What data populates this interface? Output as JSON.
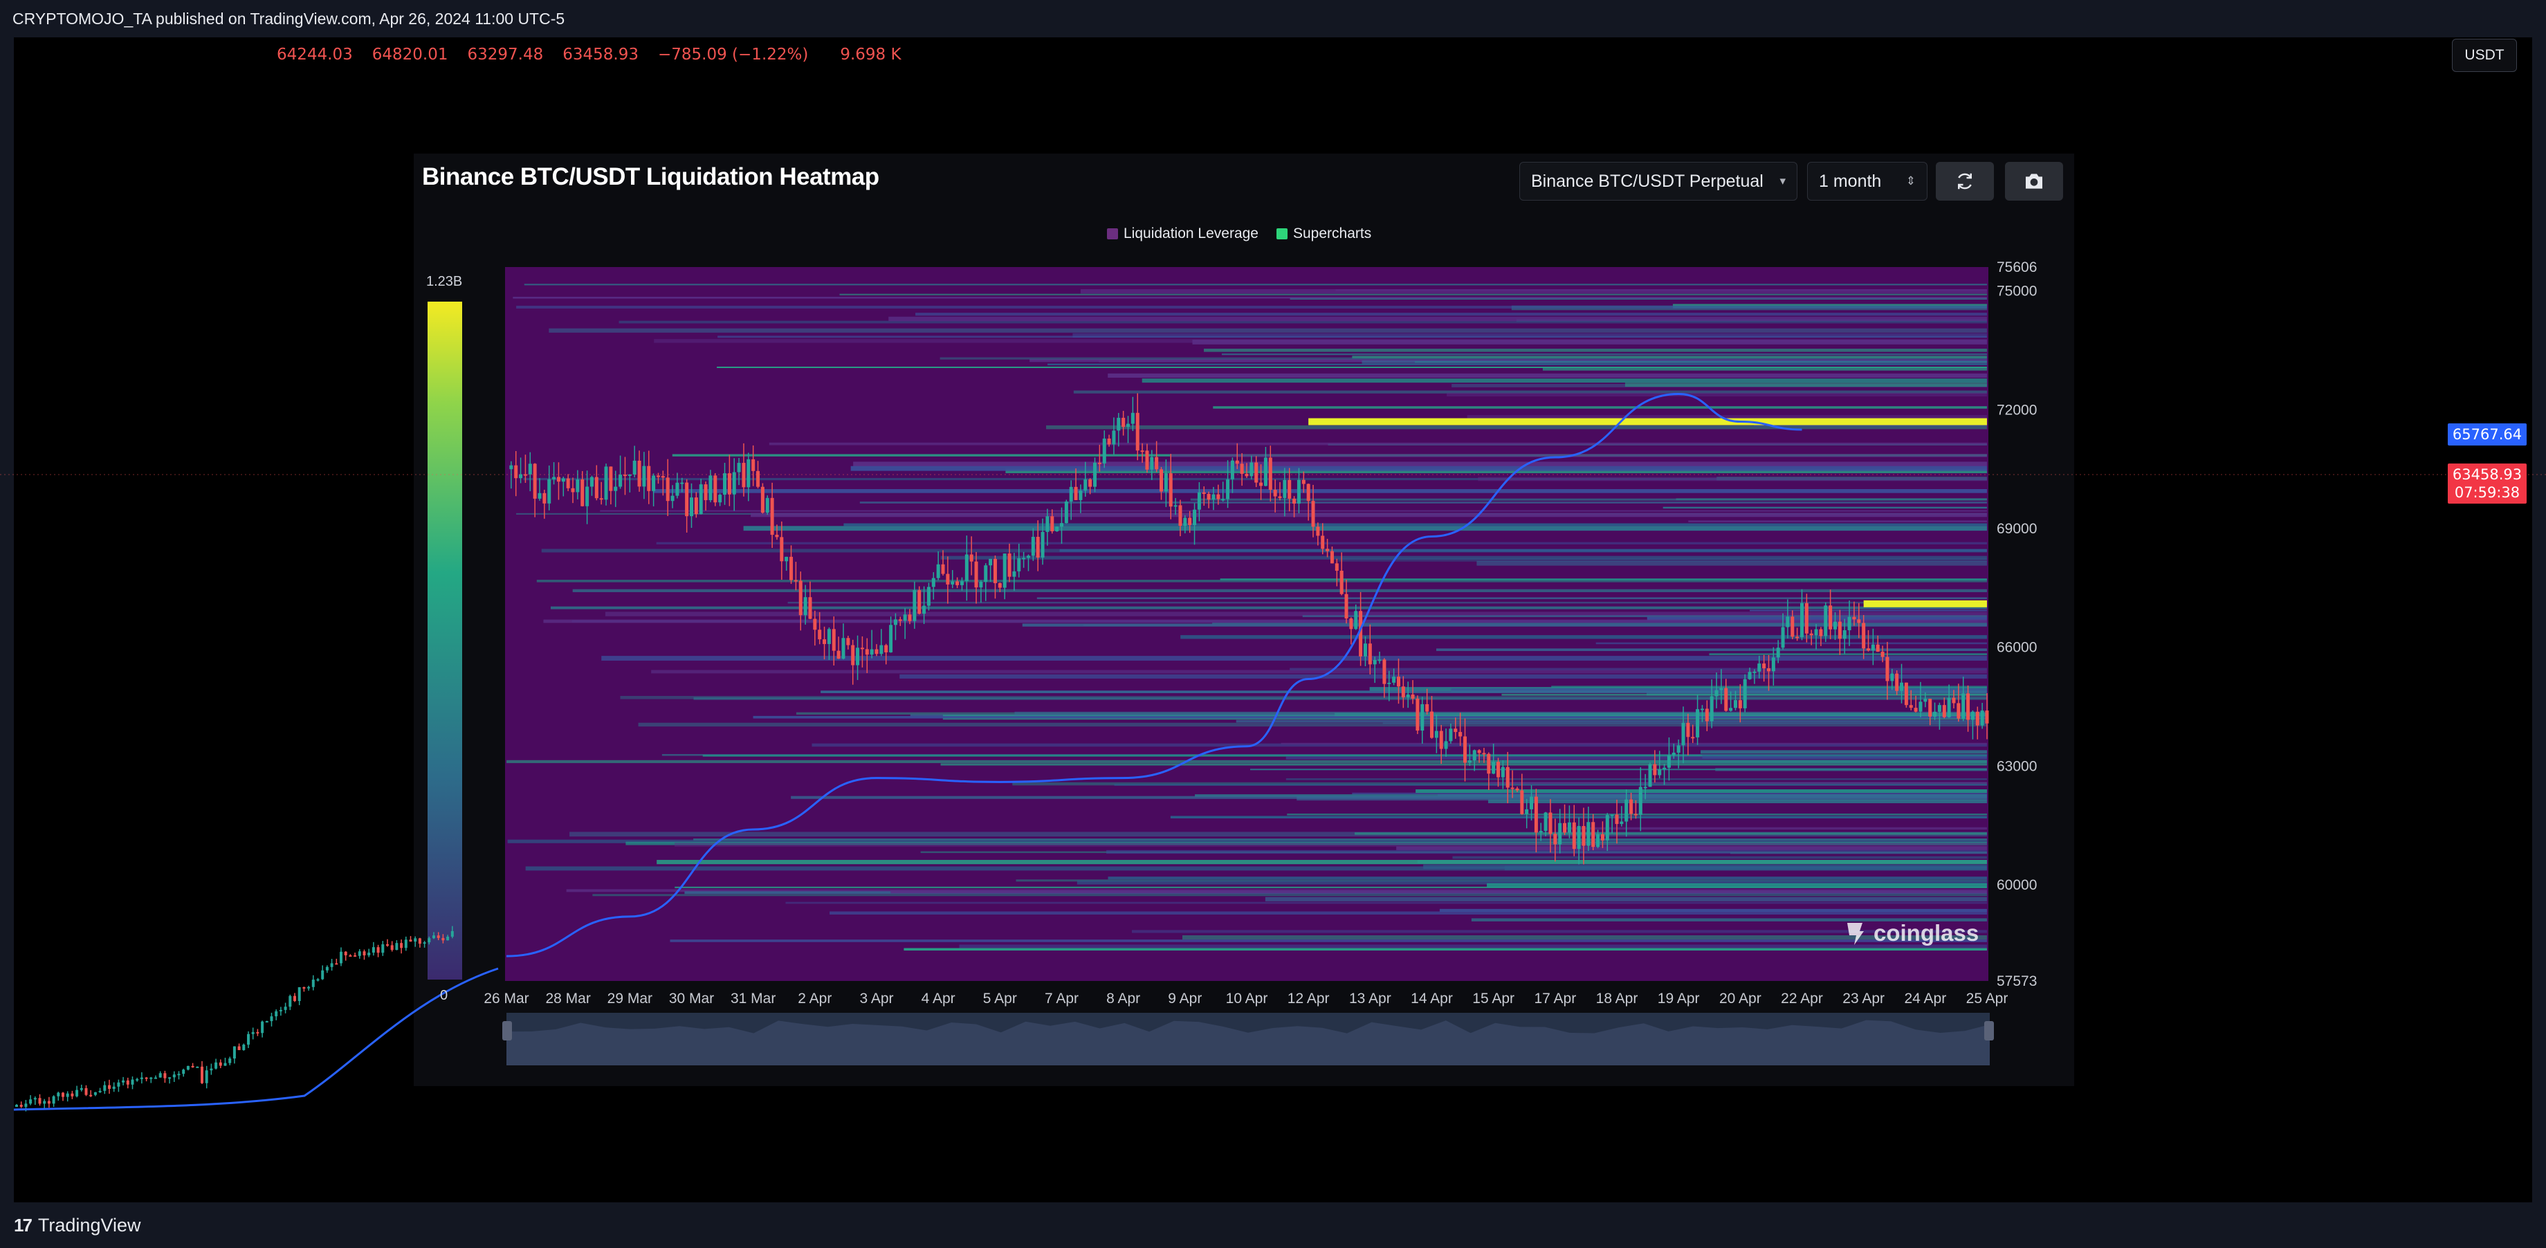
{
  "header": {
    "published_line": "CRYPTOMOJO_TA published on TradingView.com, Apr 26, 2024 11:00 UTC-5"
  },
  "ohlc": {
    "open": "64244.03",
    "high": "64820.01",
    "low": "63297.48",
    "close": "63458.93",
    "change": "−785.09 (−1.22%)",
    "volume": "9.698 K"
  },
  "currency_button": "USDT",
  "price_tags": {
    "line_value": "65767.64",
    "last_price": "63458.93",
    "countdown": "07:59:38"
  },
  "heatmap_panel": {
    "title": "Binance BTC/USDT Liquidation Heatmap",
    "pair_select": "Binance BTC/USDT Perpetual",
    "range_select": "1 month",
    "refresh_icon": "refresh-icon",
    "camera_icon": "camera-icon",
    "legend": [
      {
        "label": "Liquidation Leverage",
        "color": "#6b2e7f"
      },
      {
        "label": "Supercharts",
        "color": "#2ed47a"
      }
    ],
    "colorbar_max": "1.23B",
    "colorbar_min": "0",
    "watermark": "coinglass"
  },
  "footer": {
    "brand": "TradingView",
    "logo_glyph": "17"
  },
  "colors": {
    "heat_bg": "#4a0a5e",
    "heat_high": "#e8f02a",
    "candle_up": "#26a69a",
    "candle_down": "#ef5350",
    "ma_line": "#2962ff"
  },
  "chart_data": {
    "type": "heatmap",
    "title": "Binance BTC/USDT Liquidation Heatmap",
    "x_ticks": [
      "26 Mar",
      "28 Mar",
      "29 Mar",
      "30 Mar",
      "31 Mar",
      "2 Apr",
      "3 Apr",
      "4 Apr",
      "5 Apr",
      "7 Apr",
      "8 Apr",
      "9 Apr",
      "10 Apr",
      "12 Apr",
      "13 Apr",
      "14 Apr",
      "15 Apr",
      "17 Apr",
      "18 Apr",
      "19 Apr",
      "20 Apr",
      "22 Apr",
      "23 Apr",
      "24 Apr",
      "25 Apr"
    ],
    "y_ticks": [
      "75606",
      "75000",
      "72000",
      "69000",
      "66000",
      "63000",
      "60000",
      "57573"
    ],
    "ylim": [
      57573,
      75606
    ],
    "bright_liquidation_levels": [
      {
        "price": 71700,
        "from": "12 Apr",
        "to": "25 Apr"
      },
      {
        "price": 67100,
        "from": "23 Apr",
        "to": "25 Apr"
      }
    ],
    "price_close_path": [
      {
        "date": "26 Mar",
        "close": 70500
      },
      {
        "date": "28 Mar",
        "close": 69800
      },
      {
        "date": "29 Mar",
        "close": 70400
      },
      {
        "date": "30 Mar",
        "close": 69700
      },
      {
        "date": "31 Mar",
        "close": 70400
      },
      {
        "date": "2 Apr",
        "close": 66200
      },
      {
        "date": "3 Apr",
        "close": 65700
      },
      {
        "date": "4 Apr",
        "close": 68000
      },
      {
        "date": "5 Apr",
        "close": 67900
      },
      {
        "date": "7 Apr",
        "close": 69200
      },
      {
        "date": "8 Apr",
        "close": 71900
      },
      {
        "date": "9 Apr",
        "close": 69200
      },
      {
        "date": "10 Apr",
        "close": 70600
      },
      {
        "date": "12 Apr",
        "close": 69800
      },
      {
        "date": "13 Apr",
        "close": 65500
      },
      {
        "date": "14 Apr",
        "close": 64000
      },
      {
        "date": "15 Apr",
        "close": 63000
      },
      {
        "date": "17 Apr",
        "close": 61200
      },
      {
        "date": "18 Apr",
        "close": 61400
      },
      {
        "date": "19 Apr",
        "close": 63900
      },
      {
        "date": "20 Apr",
        "close": 64900
      },
      {
        "date": "22 Apr",
        "close": 66800
      },
      {
        "date": "23 Apr",
        "close": 66400
      },
      {
        "date": "24 Apr",
        "close": 64300
      },
      {
        "date": "25 Apr",
        "close": 64500
      }
    ],
    "ma_path": [
      {
        "date": "26 Mar",
        "value": 58200
      },
      {
        "date": "29 Mar",
        "value": 59200
      },
      {
        "date": "31 Mar",
        "value": 61400
      },
      {
        "date": "3 Apr",
        "value": 62700
      },
      {
        "date": "5 Apr",
        "value": 62600
      },
      {
        "date": "8 Apr",
        "value": 62700
      },
      {
        "date": "10 Apr",
        "value": 63500
      },
      {
        "date": "12 Apr",
        "value": 65200
      },
      {
        "date": "14 Apr",
        "value": 68800
      },
      {
        "date": "17 Apr",
        "value": 70800
      },
      {
        "date": "19 Apr",
        "value": 72400
      },
      {
        "date": "20 Apr",
        "value": 71700
      },
      {
        "date": "22 Apr",
        "value": 71500
      }
    ],
    "legend": [
      "Liquidation Leverage",
      "Supercharts"
    ],
    "grid": false
  }
}
